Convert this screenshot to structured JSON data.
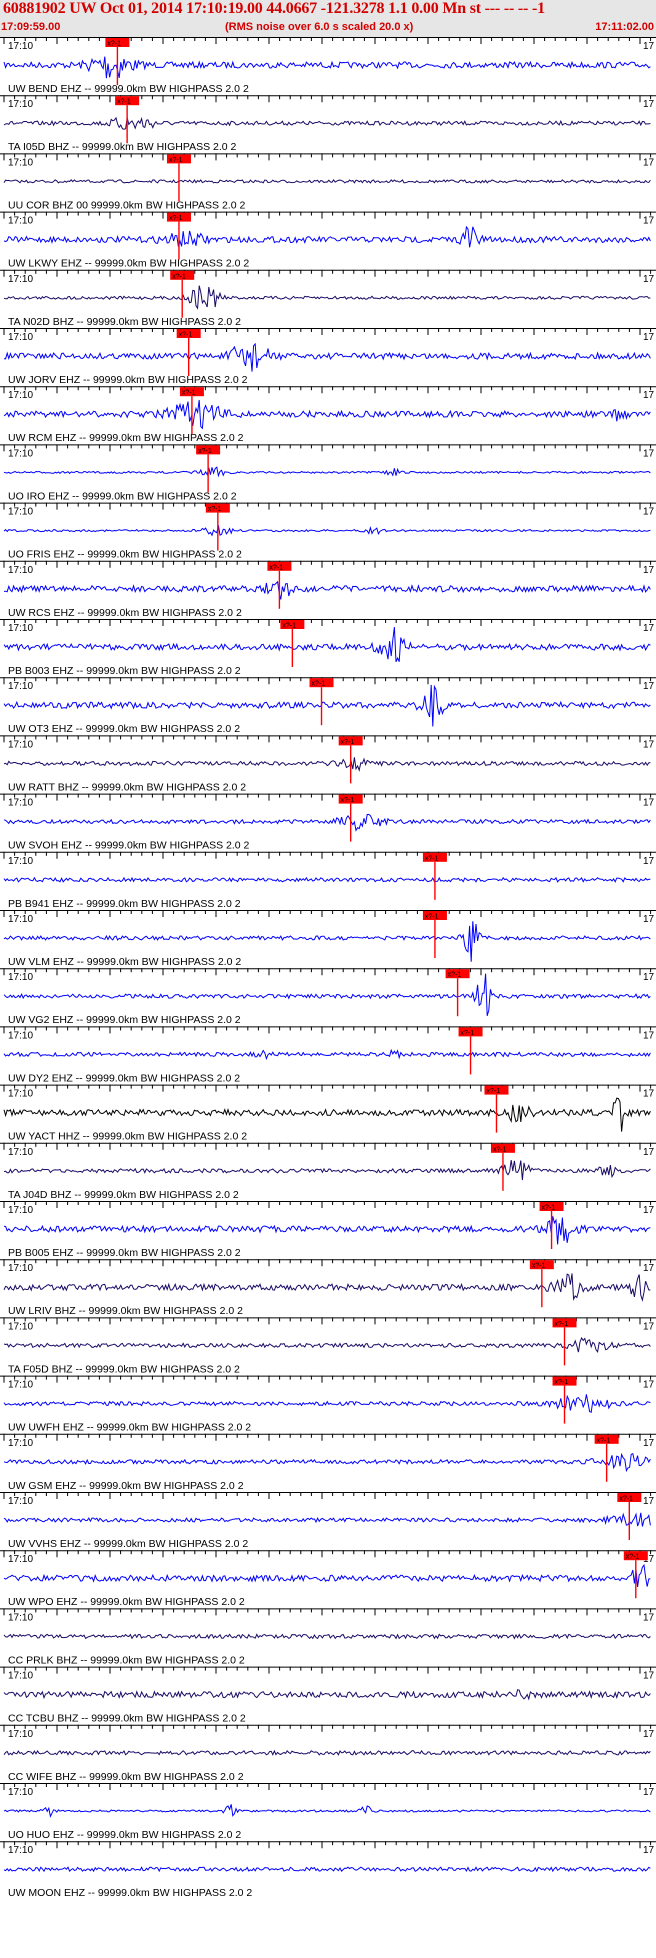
{
  "header": {
    "title": "60881902 UW Oct 01, 2014 17:10:19.00   44.0667 -121.3278  1.1 0.00 Mn st --- -- --  -1",
    "start_time": "17:09:59.00",
    "noise_note": "(RMS noise over 6.0 s scaled 20.0 x)",
    "end_time": "17:11:02.00"
  },
  "tick_label": "17:10",
  "edge_label": "17",
  "pick_label": "x?-1",
  "colors": {
    "trace_blue": "#0000ff",
    "trace_dark": "#1a0a66",
    "trace_black": "#000000",
    "pick_red": "#ff0000",
    "header_red": "#d40000",
    "header_bg": "#e6e6e6"
  },
  "traces": [
    {
      "label": "UW BEND EHZ -- 99999.0km BW  HIGHPASS  2.0  2",
      "pick": 0.175,
      "color": "blue",
      "amp": 3,
      "bursts": [
        [
          0.165,
          3,
          14
        ]
      ]
    },
    {
      "label": "TA I05D BHZ -- 99999.0km BW  HIGHPASS  2.0  2",
      "pick": 0.19,
      "color": "dark",
      "amp": 2,
      "bursts": [
        [
          0.2,
          3,
          8
        ]
      ]
    },
    {
      "label": "UU COR BHZ 00 99999.0km BW  HIGHPASS  2.0  2",
      "pick": 0.27,
      "color": "dark",
      "amp": 1.5,
      "bursts": []
    },
    {
      "label": "UW LKWY EHZ -- 99999.0km BW  HIGHPASS  2.0  2",
      "pick": 0.27,
      "color": "blue",
      "amp": 3,
      "bursts": [
        [
          0.28,
          3,
          6
        ],
        [
          0.72,
          1,
          22
        ]
      ]
    },
    {
      "label": "TA N02D BHZ -- 99999.0km BW  HIGHPASS  2.0  2",
      "pick": 0.275,
      "color": "dark",
      "amp": 1.5,
      "bursts": [
        [
          0.31,
          2,
          16
        ]
      ]
    },
    {
      "label": "UW JORV EHZ -- 99999.0km BW  HIGHPASS  2.0  2",
      "pick": 0.285,
      "color": "blue",
      "amp": 3,
      "bursts": [
        [
          0.38,
          2.5,
          16
        ]
      ]
    },
    {
      "label": "UW RCM EHZ -- 99999.0km BW  HIGHPASS  2.0  2",
      "pick": 0.29,
      "color": "blue",
      "amp": 3,
      "bursts": [
        [
          0.295,
          4,
          12
        ],
        [
          0.95,
          1,
          5
        ]
      ]
    },
    {
      "label": "UO IRO EHZ -- 99999.0km BW  HIGHPASS  2.0  2",
      "pick": 0.315,
      "color": "blue",
      "amp": 1,
      "bursts": [
        [
          0.32,
          2,
          5
        ],
        [
          0.6,
          1,
          4
        ]
      ]
    },
    {
      "label": "UO FRIS EHZ -- 99999.0km BW  HIGHPASS  2.0  2",
      "pick": 0.33,
      "color": "blue",
      "amp": 1,
      "bursts": [
        [
          0.33,
          2,
          5
        ],
        [
          0.57,
          1,
          4
        ]
      ]
    },
    {
      "label": "UW RCS EHZ -- 99999.0km BW  HIGHPASS  2.0  2",
      "pick": 0.425,
      "color": "blue",
      "amp": 3,
      "bursts": [
        [
          0.425,
          2,
          8
        ]
      ]
    },
    {
      "label": "PB B003 EHZ -- 99999.0km BW  HIGHPASS  2.0  2",
      "pick": 0.445,
      "color": "blue",
      "amp": 3,
      "bursts": [
        [
          0.6,
          1.8,
          18
        ]
      ]
    },
    {
      "label": "UW OT3 EHZ -- 99999.0km BW  HIGHPASS  2.0  2",
      "pick": 0.49,
      "color": "blue",
      "amp": 3,
      "bursts": [
        [
          0.66,
          1.5,
          20
        ]
      ]
    },
    {
      "label": "UW RATT BHZ -- 99999.0km BW  HIGHPASS  2.0  2",
      "pick": 0.535,
      "color": "dark",
      "amp": 2,
      "bursts": [
        [
          0.55,
          3,
          5
        ]
      ]
    },
    {
      "label": "UW SVOH EHZ -- 99999.0km BW  HIGHPASS  2.0  2",
      "pick": 0.535,
      "color": "blue",
      "amp": 2,
      "bursts": [
        [
          0.55,
          3,
          8
        ]
      ]
    },
    {
      "label": "PB B941 EHZ -- 99999.0km BW  HIGHPASS  2.0  2",
      "pick": 0.665,
      "color": "blue",
      "amp": 2,
      "bursts": []
    },
    {
      "label": "UW VLM EHZ -- 99999.0km BW  HIGHPASS  2.0  2",
      "pick": 0.665,
      "color": "blue",
      "amp": 2,
      "bursts": [
        [
          0.72,
          1,
          26
        ]
      ]
    },
    {
      "label": "UW VG2 EHZ -- 99999.0km BW  HIGHPASS  2.0  2",
      "pick": 0.7,
      "color": "blue",
      "amp": 2,
      "bursts": [
        [
          0.74,
          1,
          26
        ]
      ]
    },
    {
      "label": "UW DY2 EHZ -- 99999.0km BW  HIGHPASS  2.0  2",
      "pick": 0.72,
      "color": "blue",
      "amp": 2,
      "bursts": [
        [
          0.4,
          1,
          4
        ],
        [
          0.6,
          1,
          4
        ]
      ]
    },
    {
      "label": "UW YACT HHZ -- 99999.0km BW  HIGHPASS  2.0  2",
      "pick": 0.76,
      "color": "black",
      "amp": 3,
      "bursts": [
        [
          0.79,
          2,
          8
        ],
        [
          0.95,
          1,
          18
        ]
      ]
    },
    {
      "label": "TA J04D BHZ -- 99999.0km BW  HIGHPASS  2.0  2",
      "pick": 0.77,
      "color": "dark",
      "amp": 2,
      "bursts": [
        [
          0.79,
          2,
          12
        ],
        [
          0.93,
          1,
          8
        ]
      ]
    },
    {
      "label": "PB B005 EHZ -- 99999.0km BW  HIGHPASS  2.0  2",
      "pick": 0.845,
      "color": "blue",
      "amp": 3,
      "bursts": [
        [
          0.86,
          2,
          16
        ]
      ]
    },
    {
      "label": "UW LRIV BHZ -- 99999.0km BW  HIGHPASS  2.0  2",
      "pick": 0.83,
      "color": "dark",
      "amp": 3,
      "bursts": [
        [
          0.87,
          2,
          14
        ],
        [
          0.98,
          1,
          18
        ]
      ]
    },
    {
      "label": "TA F05D BHZ -- 99999.0km BW  HIGHPASS  2.0  2",
      "pick": 0.865,
      "color": "dark",
      "amp": 2,
      "bursts": [
        [
          0.9,
          3,
          6
        ]
      ]
    },
    {
      "label": "UW UWFH EHZ -- 99999.0km BW  HIGHPASS  2.0  2",
      "pick": 0.865,
      "color": "blue",
      "amp": 2,
      "bursts": [
        [
          0.89,
          4,
          8
        ]
      ]
    },
    {
      "label": "UW GSM EHZ -- 99999.0km BW  HIGHPASS  2.0  2",
      "pick": 0.93,
      "color": "blue",
      "amp": 2,
      "bursts": [
        [
          0.96,
          4,
          8
        ]
      ]
    },
    {
      "label": "UW VVHS EHZ -- 99999.0km BW  HIGHPASS  2.0  2",
      "pick": 0.965,
      "color": "blue",
      "amp": 2,
      "bursts": [
        [
          0.975,
          4,
          6
        ]
      ]
    },
    {
      "label": "UW WPO EHZ -- 99999.0km BW  HIGHPASS  2.0  2",
      "pick": 0.975,
      "color": "blue",
      "amp": 3,
      "bursts": [
        [
          0.99,
          2,
          14
        ]
      ]
    },
    {
      "label": "CC PRLK BHZ -- 99999.0km BW  HIGHPASS  2.0  2",
      "pick": null,
      "color": "dark",
      "amp": 2,
      "bursts": []
    },
    {
      "label": "CC TCBU BHZ -- 99999.0km BW  HIGHPASS  2.0  2",
      "pick": null,
      "color": "dark",
      "amp": 3,
      "bursts": [
        [
          0.8,
          1,
          5
        ]
      ]
    },
    {
      "label": "CC WIFE BHZ -- 99999.0km BW  HIGHPASS  2.0  2",
      "pick": null,
      "color": "dark",
      "amp": 2,
      "bursts": []
    },
    {
      "label": "UO HUO EHZ -- 99999.0km BW  HIGHPASS  2.0  2",
      "pick": null,
      "color": "blue",
      "amp": 1,
      "bursts": [
        [
          0.07,
          1,
          5
        ],
        [
          0.35,
          1,
          6
        ],
        [
          0.56,
          1,
          5
        ]
      ]
    },
    {
      "label": "UW MOON EHZ -- 99999.0km BW  HIGHPASS  2.0  2",
      "pick": null,
      "color": "blue",
      "amp": 2,
      "bursts": []
    }
  ]
}
